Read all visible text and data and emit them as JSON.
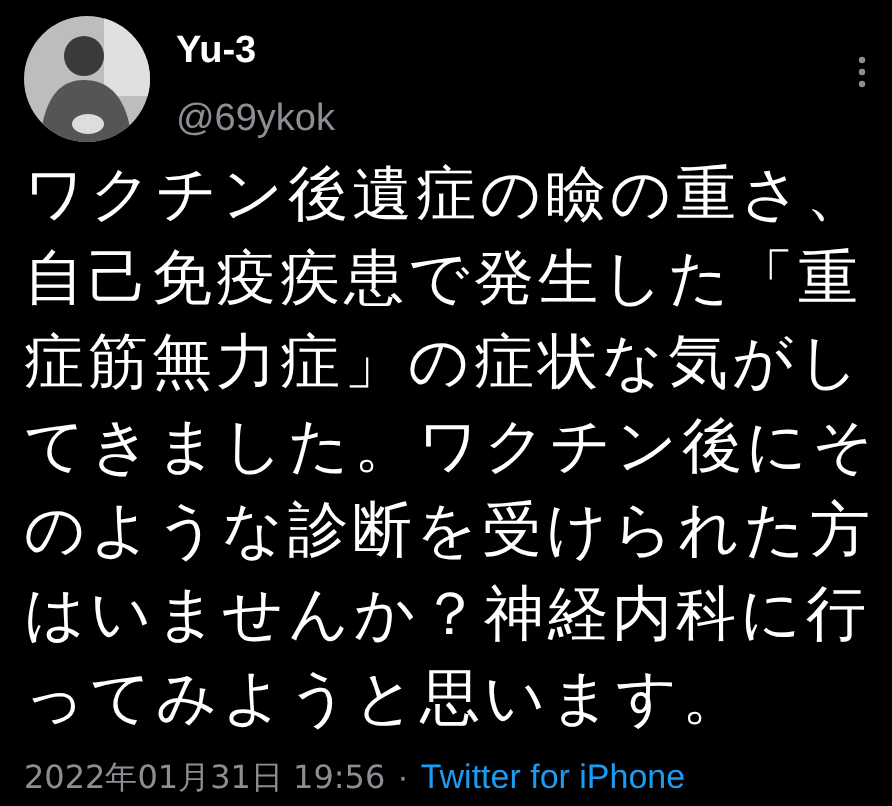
{
  "author": {
    "name": "Yu-3",
    "handle": "@69ykok"
  },
  "text": "ワクチン後遺症の瞼の重さ、自己免疫疾患で発生した「重症筋無力症」の症状な気がしてきました。ワクチン後にそのような診断を受けられた方はいませんか？神経内科に行ってみようと思います。",
  "timestamp": "2022年01月31日 19:56",
  "separator": "·",
  "source": "Twitter for iPhone"
}
